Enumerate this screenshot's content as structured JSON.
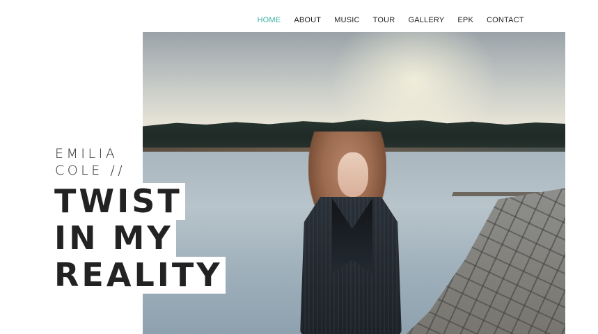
{
  "nav": {
    "items": [
      {
        "label": "HOME",
        "active": true
      },
      {
        "label": "ABOUT",
        "active": false
      },
      {
        "label": "MUSIC",
        "active": false
      },
      {
        "label": "TOUR",
        "active": false
      },
      {
        "label": "GALLERY",
        "active": false
      },
      {
        "label": "EPK",
        "active": false
      },
      {
        "label": "CONTACT",
        "active": false
      }
    ],
    "active_color": "#3bb3a2"
  },
  "hero": {
    "artist_line1": "EMILIA",
    "artist_line2": "COLE //",
    "title_lines": [
      "TWIST",
      "IN MY",
      "REALITY"
    ]
  },
  "photo": {
    "subject": "woman-by-lake-photo"
  }
}
